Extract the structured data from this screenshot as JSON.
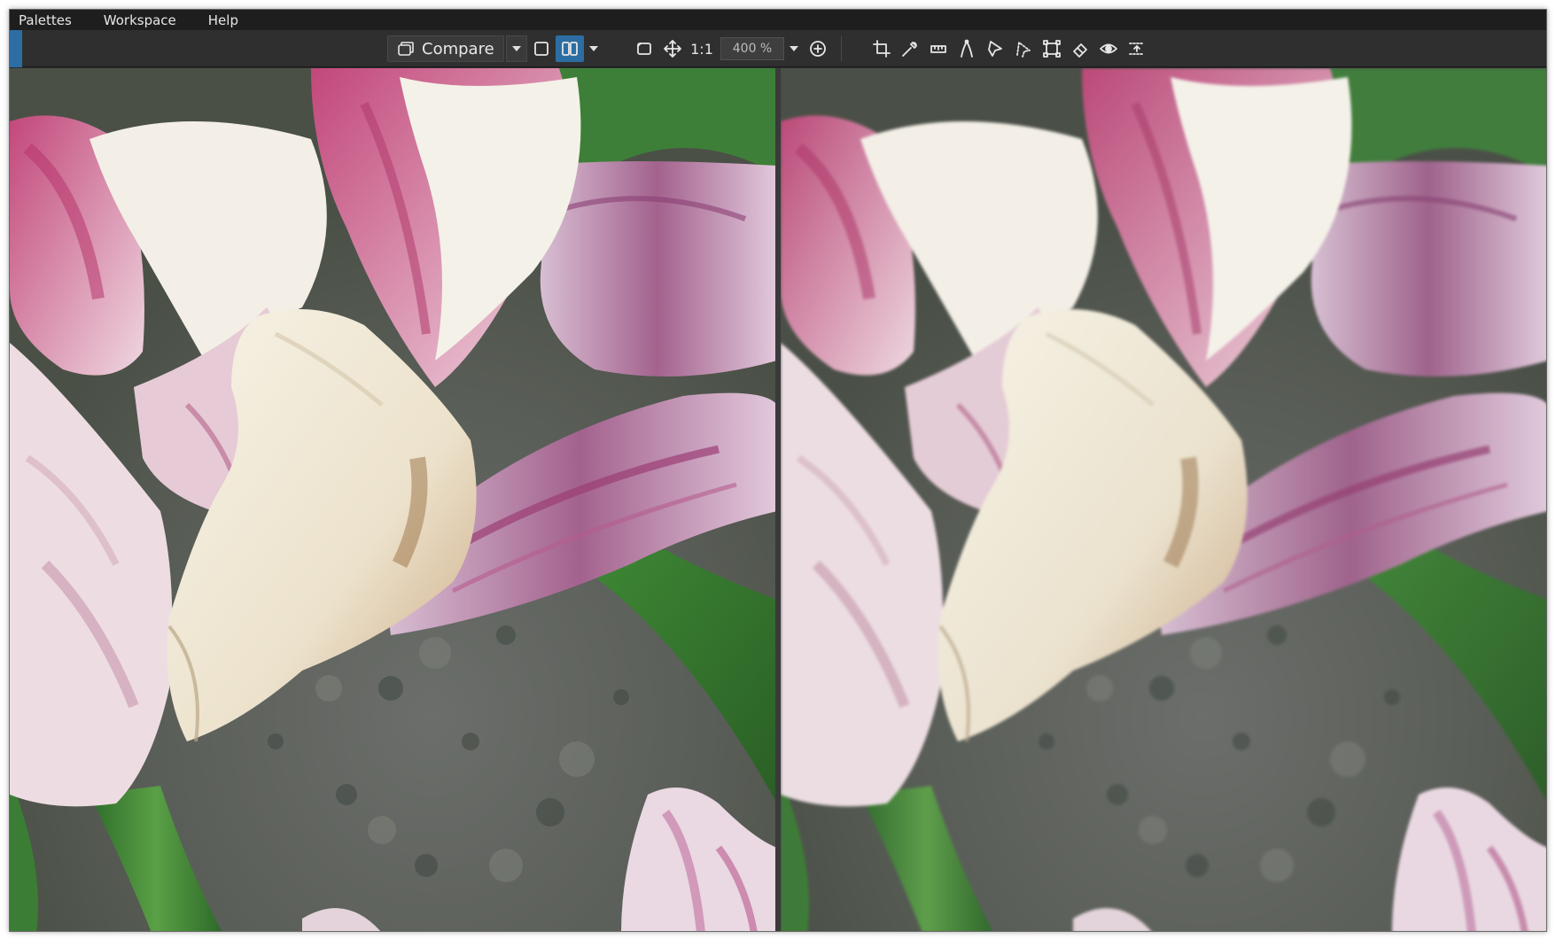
{
  "menu": {
    "items": [
      "Palettes",
      "Workspace",
      "Help"
    ]
  },
  "toolbar": {
    "compare_label": "Compare",
    "ratio_label": "1:1",
    "zoom_value": "400 %",
    "icons": [
      "compare-icon",
      "single-view-icon",
      "split-view-icon",
      "frame-icon",
      "pan-icon",
      "zoom-in-icon",
      "crop-icon",
      "eyedropper-icon",
      "straighten-icon",
      "pen-icon",
      "polygon-lasso-icon",
      "freehand-lasso-icon",
      "transform-icon",
      "eraser-icon",
      "eye-icon",
      "guides-icon"
    ]
  },
  "colors": {
    "accent": "#2c6ea3",
    "toolbar_bg": "#2f2f2f",
    "menubar_bg": "#1e1e1e"
  }
}
